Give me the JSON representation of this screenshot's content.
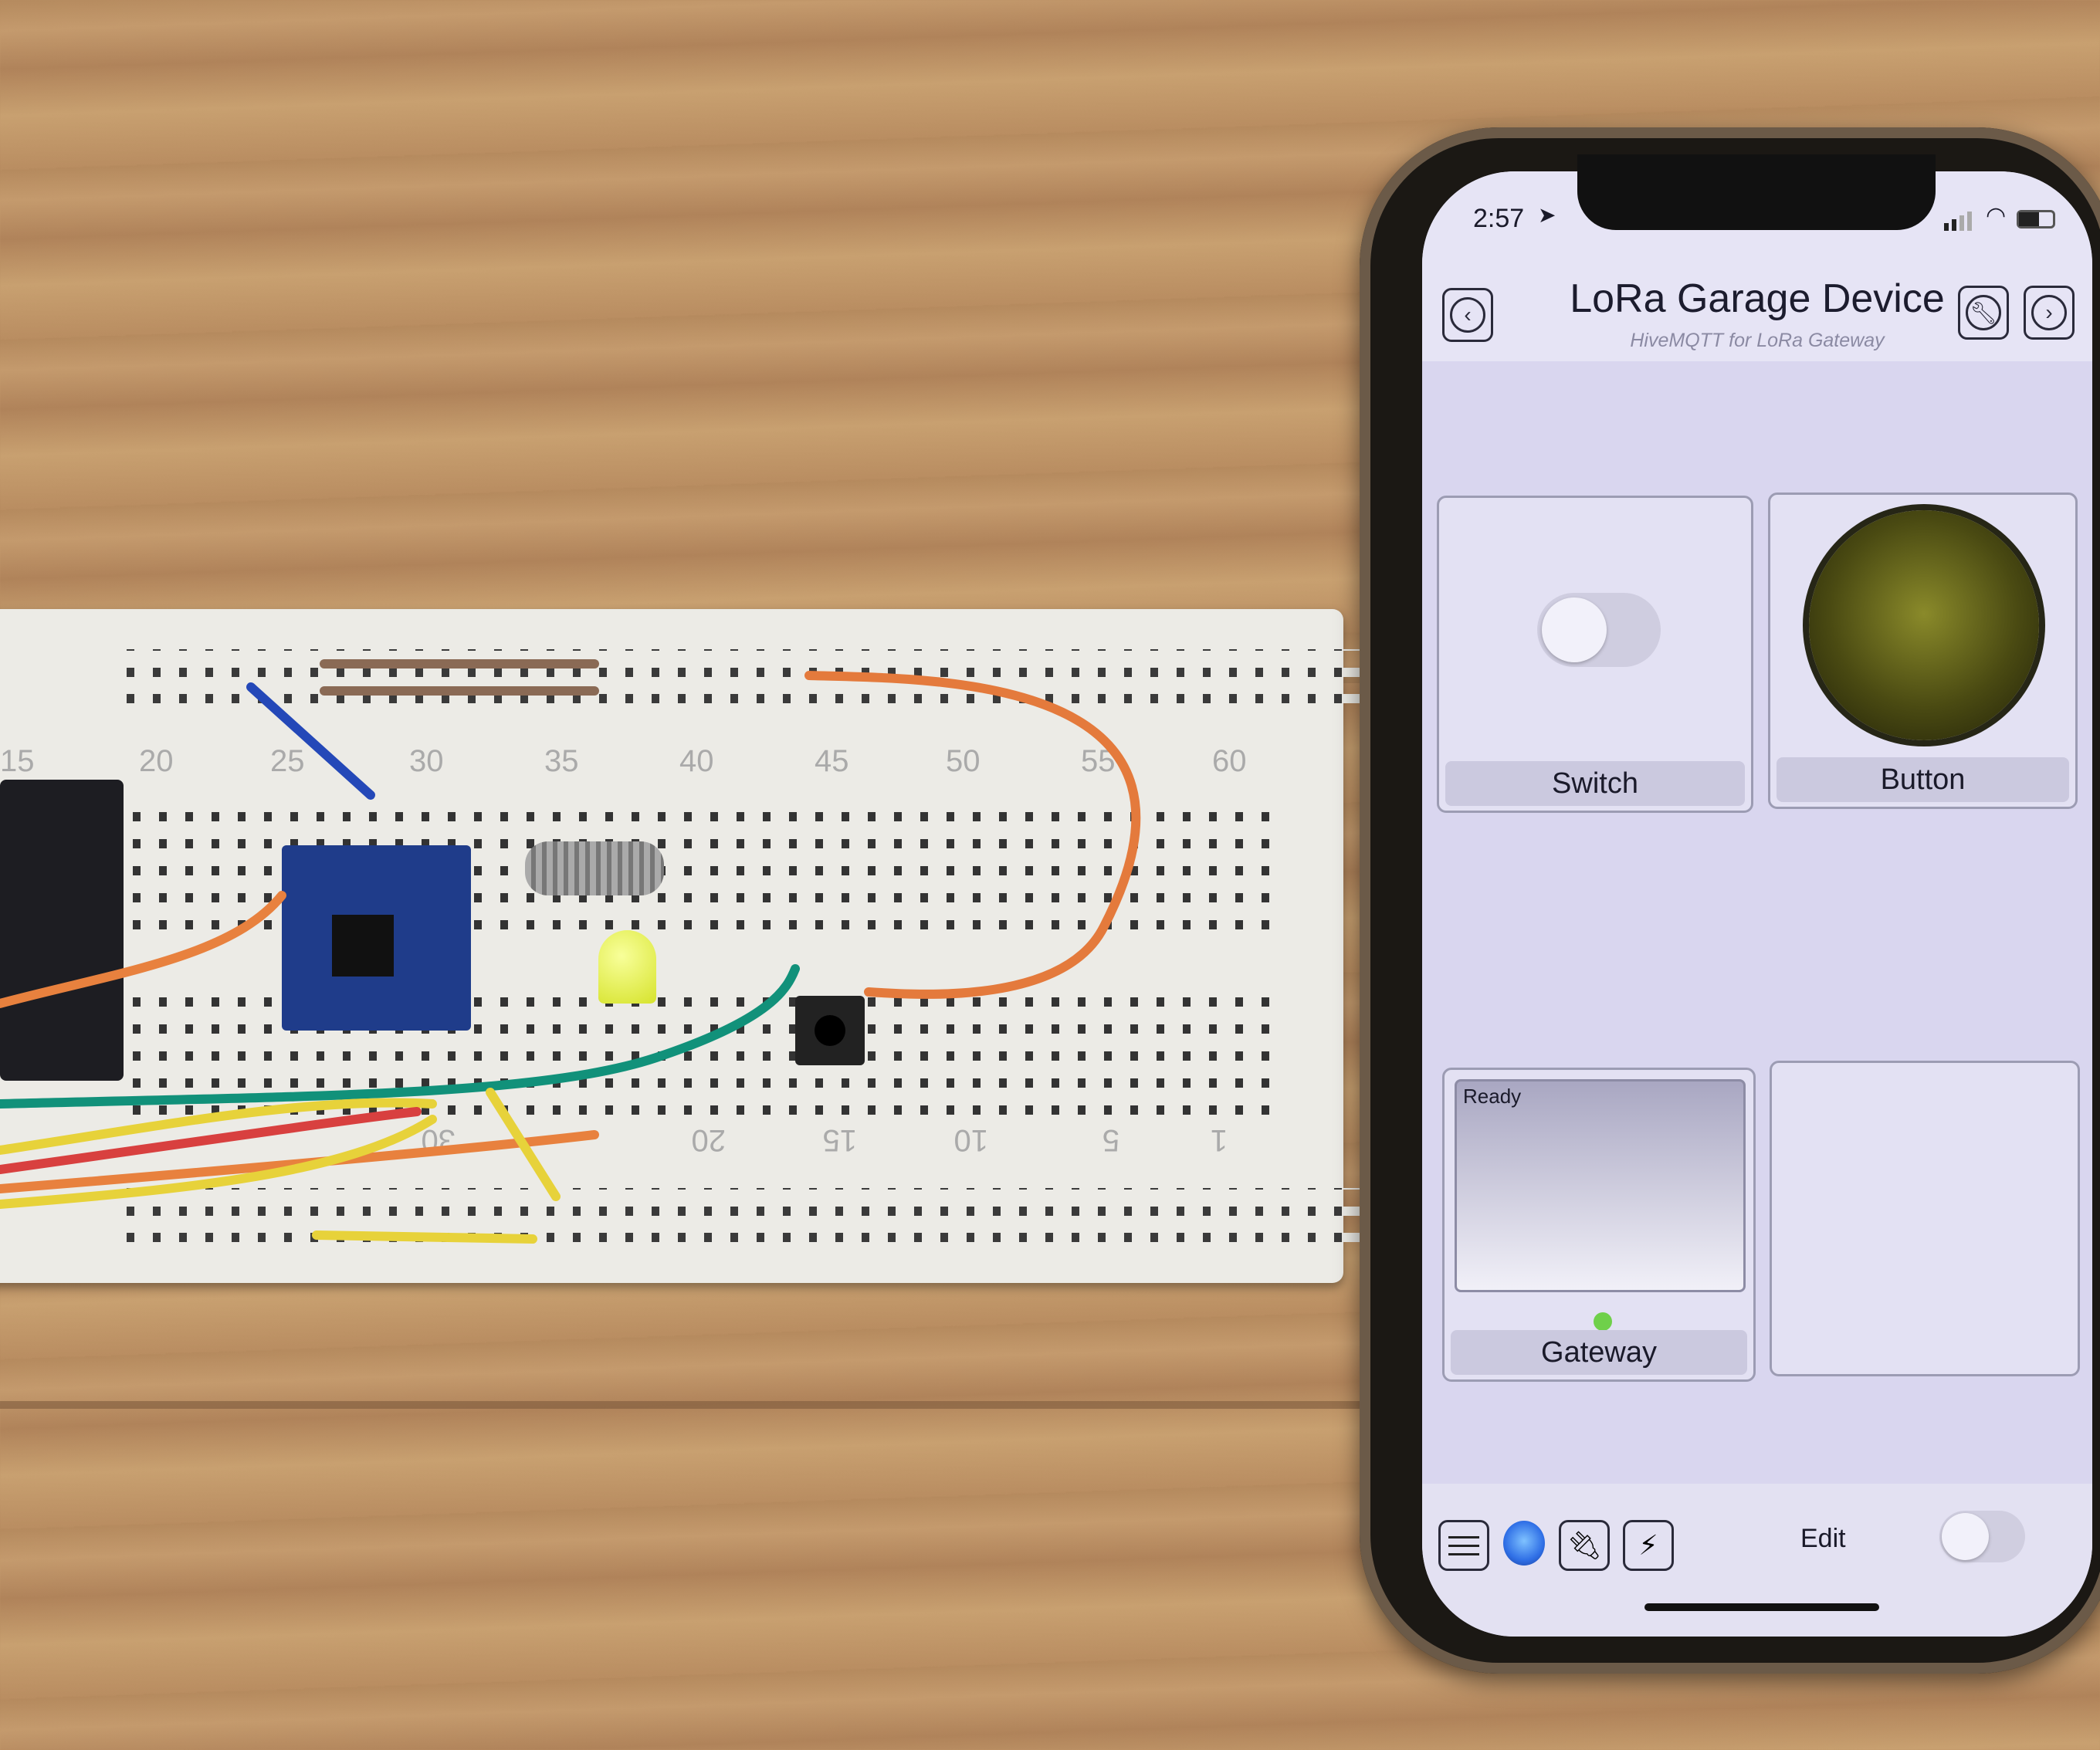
{
  "breadboard": {
    "top_numbers": [
      "15",
      "20",
      "25",
      "30",
      "35",
      "40",
      "45",
      "50",
      "55",
      "60"
    ],
    "bottom_numbers": [
      "30",
      "20",
      "15",
      "10",
      "5",
      "1"
    ]
  },
  "status_bar": {
    "time": "2:57"
  },
  "header": {
    "title": "LoRa Garage Device",
    "subtitle": "HiveMQTT for LoRa Gateway",
    "back_icon": "chevron-left-circle",
    "settings_icon": "wrench-circle",
    "forward_icon": "chevron-right-circle"
  },
  "widgets": {
    "switch": {
      "label": "Switch",
      "state": "off"
    },
    "button": {
      "label": "Button",
      "color": "#4a4a12"
    },
    "gateway": {
      "label": "Gateway",
      "status": "Ready",
      "indicator_color": "#6fd04a"
    }
  },
  "toolbar": {
    "edit_label": "Edit",
    "status_dot_color": "#2f6fe6",
    "edit_toggle": "off"
  }
}
